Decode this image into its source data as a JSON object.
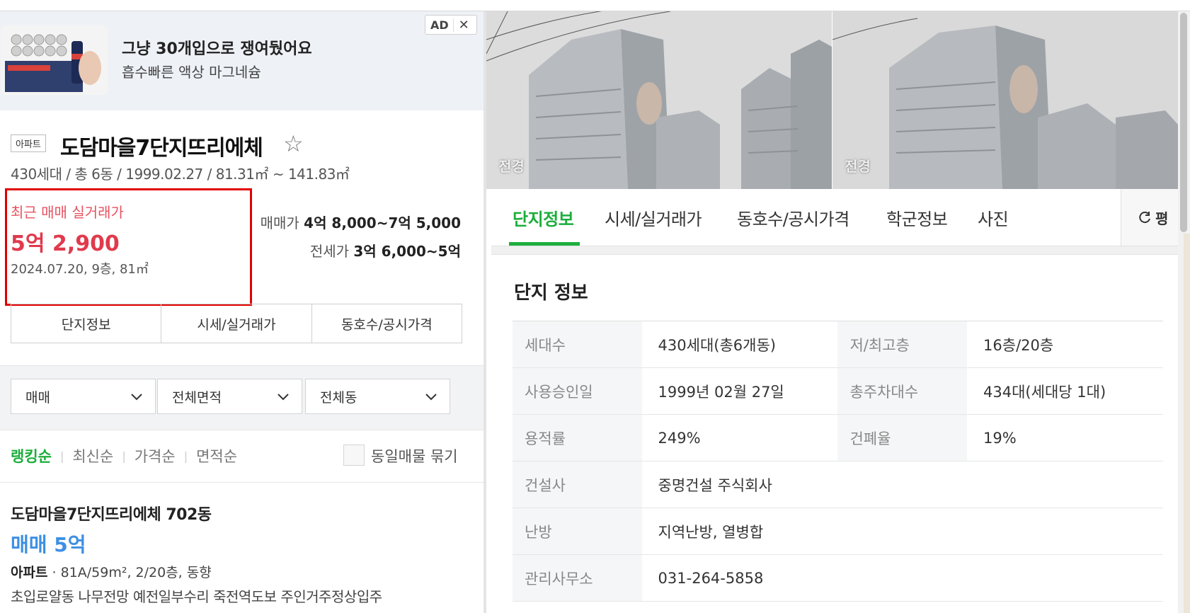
{
  "ad": {
    "tag": "AD",
    "close": "✕",
    "title": "그냥 30개입으로 쟁여뒀어요",
    "subtitle": "흡수빠른 액상 마그네슘"
  },
  "complex": {
    "type": "아파트",
    "name": "도담마을7단지뜨리에체",
    "summary": "430세대 / 총 6동 / 1999.02.27 / 81.31㎡ ~ 141.83㎡"
  },
  "recent_trade": {
    "label": "최근 매매 실거래가",
    "price": "5억 2,900",
    "detail": "2024.07.20, 9층, 81㎡"
  },
  "prices": {
    "sale_label": "매매가",
    "sale_range": "4억 8,000~7억 5,000",
    "jeonse_label": "전세가",
    "jeonse_range": "3억 6,000~5억"
  },
  "left_tabs": [
    "단지정보",
    "시세/실거래가",
    "동호수/공시가격"
  ],
  "filters": [
    "매매",
    "전체면적",
    "전체동"
  ],
  "sort": {
    "options": [
      "랭킹순",
      "최신순",
      "가격순",
      "면적순"
    ],
    "active": "랭킹순",
    "group_label": "동일매물 묶기"
  },
  "listing": {
    "title": "도담마을7단지뜨리에체 702동",
    "price": "매매 5억",
    "spec_type": "아파트",
    "spec_rest": " · 81A/59m², 2/20층, 동향",
    "description": "초입로얄동 나무전망 예전일부수리 죽전역도보 주인거주정상입주"
  },
  "photos": [
    {
      "label": "전경"
    },
    {
      "label": "전경"
    }
  ],
  "right_tabs": [
    "단지정보",
    "시세/실거래가",
    "동호수/공시가격",
    "학군정보",
    "사진"
  ],
  "right_active_tab": "단지정보",
  "pyeong_label": "평",
  "info": {
    "title": "단지 정보",
    "rows": [
      {
        "k1": "세대수",
        "v1": "430세대(총6개동)",
        "k2": "저/최고층",
        "v2": "16층/20층"
      },
      {
        "k1": "사용승인일",
        "v1": "1999년 02월 27일",
        "k2": "총주차대수",
        "v2": "434대(세대당 1대)"
      },
      {
        "k1": "용적률",
        "v1": "249%",
        "k2": "건폐율",
        "v2": "19%"
      },
      {
        "k1": "건설사",
        "v1": "중명건설 주식회사"
      },
      {
        "k1": "난방",
        "v1": "지역난방, 열병합"
      },
      {
        "k1": "관리사무소",
        "v1": "031-264-5858"
      }
    ]
  },
  "colors": {
    "accent_green": "#1cae3c",
    "recent_red": "#e03a4c",
    "listing_blue": "#3d8fe4",
    "highlight_box": "#e10000"
  }
}
